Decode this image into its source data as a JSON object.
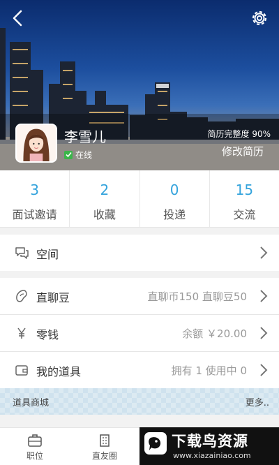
{
  "header": {
    "user_name": "李雪儿",
    "online_label": "在线",
    "completeness": "简历完整度 90%",
    "edit_resume": "修改简历"
  },
  "stats": [
    {
      "value": "3",
      "label": "面试邀请"
    },
    {
      "value": "2",
      "label": "收藏"
    },
    {
      "value": "0",
      "label": "投递"
    },
    {
      "value": "15",
      "label": "交流"
    }
  ],
  "rows": {
    "space": {
      "title": "空间",
      "icon": "chat-bubbles-icon"
    },
    "beans": {
      "title": "直聊豆",
      "value": "直聊币150  直聊豆50",
      "icon": "bean-icon"
    },
    "wallet": {
      "title": "零钱",
      "value": "余额 ￥20.00",
      "icon": "yuan-icon"
    },
    "props": {
      "title": "我的道具",
      "value": "拥有 1   使用中  0",
      "icon": "wallet-icon"
    }
  },
  "shop": {
    "title": "道具商城",
    "more": "更多.."
  },
  "bottom_nav": [
    {
      "label": "职位",
      "icon": "briefcase-icon"
    },
    {
      "label": "直友圈",
      "icon": "building-icon"
    }
  ],
  "watermark": {
    "title": "下载鸟资源",
    "url": "www.xiazainiao.com"
  },
  "colors": {
    "accent": "#33a3dc",
    "online": "#3bb54a"
  }
}
